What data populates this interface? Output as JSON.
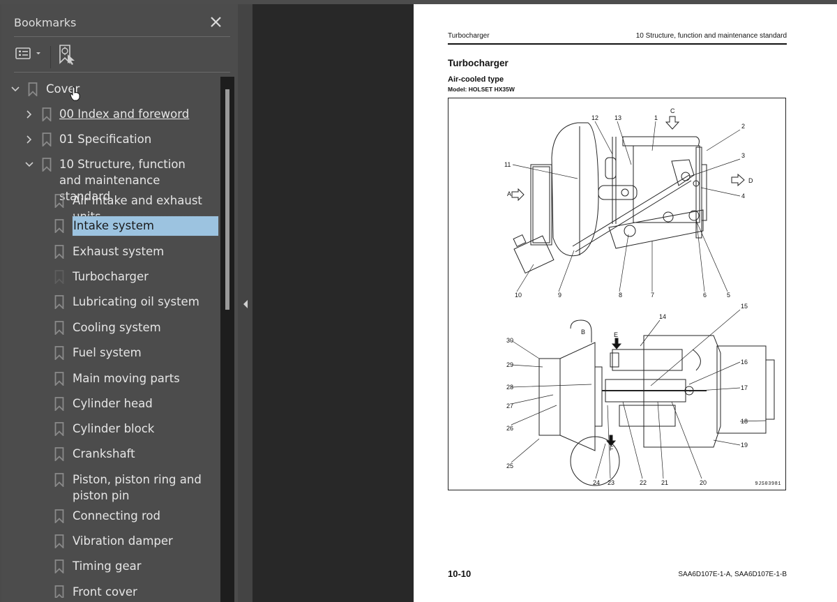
{
  "bookmarks_panel": {
    "title": "Bookmarks",
    "close_icon": "close-icon",
    "toolbar": {
      "options_icon": "list-options-icon",
      "new_bookmark_icon": "new-bookmark-icon"
    },
    "items": [
      {
        "label": "Cover",
        "level": 0,
        "expander": "expanded",
        "dim_icon": false,
        "link": false,
        "selected": false
      },
      {
        "label": "00 Index and foreword",
        "level": 1,
        "expander": "collapsed",
        "dim_icon": false,
        "link": true,
        "selected": false
      },
      {
        "label": "01 Specification",
        "level": 1,
        "expander": "collapsed",
        "dim_icon": false,
        "link": false,
        "selected": false
      },
      {
        "label": "10 Structure, function and maintenance standard",
        "level": 1,
        "expander": "expanded",
        "dim_icon": false,
        "link": false,
        "selected": false
      },
      {
        "label": "Air intake and exhaust units",
        "level": 2,
        "expander": "none",
        "dim_icon": false,
        "link": false,
        "selected": false
      },
      {
        "label": "Intake system",
        "level": 2,
        "expander": "none",
        "dim_icon": false,
        "link": false,
        "selected": true
      },
      {
        "label": "Exhaust system",
        "level": 2,
        "expander": "none",
        "dim_icon": false,
        "link": false,
        "selected": false
      },
      {
        "label": "Turbocharger",
        "level": 2,
        "expander": "none",
        "dim_icon": true,
        "link": false,
        "selected": false
      },
      {
        "label": "Lubricating oil system",
        "level": 2,
        "expander": "none",
        "dim_icon": false,
        "link": false,
        "selected": false
      },
      {
        "label": "Cooling system",
        "level": 2,
        "expander": "none",
        "dim_icon": false,
        "link": false,
        "selected": false
      },
      {
        "label": "Fuel system",
        "level": 2,
        "expander": "none",
        "dim_icon": false,
        "link": false,
        "selected": false
      },
      {
        "label": "Main moving parts",
        "level": 2,
        "expander": "none",
        "dim_icon": false,
        "link": false,
        "selected": false
      },
      {
        "label": "Cylinder head",
        "level": 2,
        "expander": "none",
        "dim_icon": false,
        "link": false,
        "selected": false
      },
      {
        "label": "Cylinder block",
        "level": 2,
        "expander": "none",
        "dim_icon": false,
        "link": false,
        "selected": false
      },
      {
        "label": "Crankshaft",
        "level": 2,
        "expander": "none",
        "dim_icon": false,
        "link": false,
        "selected": false
      },
      {
        "label": "Piston, piston ring and piston pin",
        "level": 2,
        "expander": "none",
        "dim_icon": false,
        "link": false,
        "selected": false
      },
      {
        "label": "Connecting rod",
        "level": 2,
        "expander": "none",
        "dim_icon": false,
        "link": false,
        "selected": false
      },
      {
        "label": "Vibration damper",
        "level": 2,
        "expander": "none",
        "dim_icon": false,
        "link": false,
        "selected": false
      },
      {
        "label": "Timing gear",
        "level": 2,
        "expander": "none",
        "dim_icon": false,
        "link": false,
        "selected": false
      },
      {
        "label": "Front cover",
        "level": 2,
        "expander": "none",
        "dim_icon": false,
        "link": false,
        "selected": false
      }
    ]
  },
  "colors": {
    "panel_bg": "#4c4c4c",
    "viewer_bg": "#282828",
    "selection_bg": "#9cc3e0",
    "text": "#e6e6e6"
  },
  "document_page": {
    "header_left": "Turbocharger",
    "header_right": "10 Structure, function and maintenance standard",
    "title": "Turbocharger",
    "subtitle": "Air-cooled type",
    "model": "Model: HOLSET HX35W",
    "figure": {
      "code": "9JS03981",
      "top_view_callouts": [
        "1",
        "2",
        "3",
        "4",
        "5",
        "6",
        "7",
        "8",
        "9",
        "10",
        "11",
        "12",
        "13"
      ],
      "top_view_flow_labels": [
        "A",
        "C",
        "D"
      ],
      "section_view_callouts": [
        "14",
        "15",
        "16",
        "17",
        "18",
        "19",
        "20",
        "21",
        "22",
        "23",
        "24",
        "25",
        "26",
        "27",
        "28",
        "29",
        "30"
      ],
      "section_view_flow_labels": [
        "B",
        "E",
        "F"
      ]
    },
    "page_number": "10-10",
    "footer_model": "SAA6D107E-1-A, SAA6D107E-1-B"
  }
}
